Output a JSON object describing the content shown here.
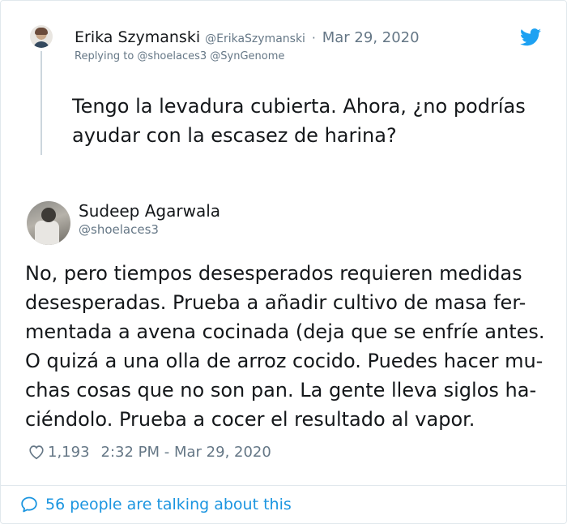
{
  "parent_tweet": {
    "author_name": "Erika Szymanski",
    "author_handle": "@ErikaSzymanski",
    "separator": "·",
    "date": "Mar 29, 2020",
    "replying_to": "Replying to @shoelaces3 @SynGenome",
    "text": "Tengo la levadura cubierta. Ahora, ¿no podrías ayudar con la escasez de harina?"
  },
  "main_tweet": {
    "author_name": "Sudeep Agarwala",
    "author_handle": "@shoelaces3",
    "text_lines": [
      "No, pero tiempos desesperados requieren medidas",
      "desesperadas. Prueba a añadir cultivo de masa fer-",
      "mentada a avena cocinada (deja que se enfríe antes.",
      "O quizá a una olla de arroz cocido. Puedes hacer mu-",
      "chas cosas que no son pan. La gente lleva siglos ha-",
      "ciéndolo. Prueba a cocer el resultado al vapor."
    ],
    "likes": "1,193",
    "timestamp": "2:32 PM - Mar 29, 2020"
  },
  "footer": {
    "talking_text": "56 people are talking about this"
  },
  "icons": {
    "brand": "twitter-bird-icon",
    "like": "heart-icon",
    "conversation": "speech-bubble-icon"
  },
  "colors": {
    "twitter_blue": "#1da1f2",
    "link_blue": "#1b95e0",
    "secondary_text": "#657786",
    "thread_line": "#ccd6dd"
  }
}
